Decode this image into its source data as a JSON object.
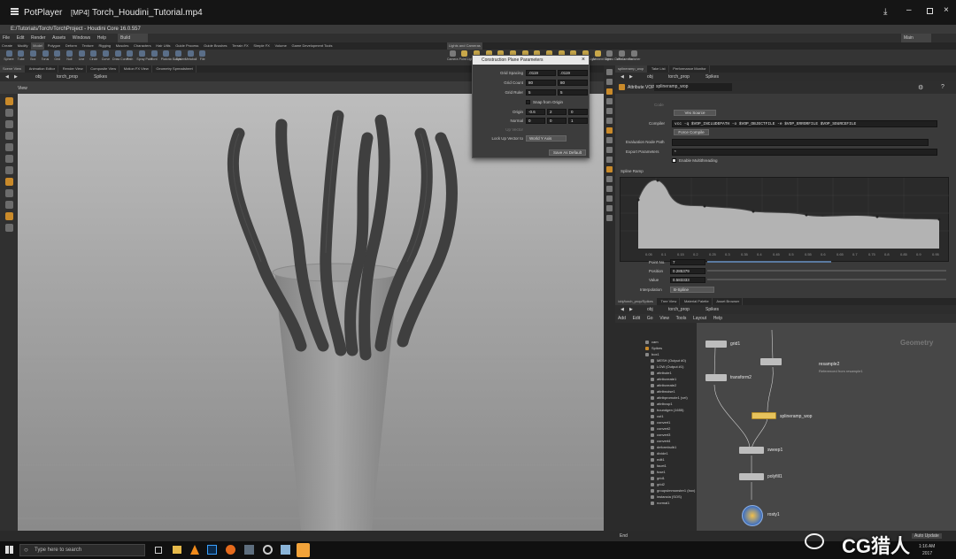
{
  "player": {
    "app_name": "PotPlayer",
    "format": "[MP4]",
    "file_name": "Torch_Houdini_Tutorial.mp4",
    "controls": [
      "download-icon",
      "minimize-icon",
      "restore-icon",
      "close-icon"
    ]
  },
  "houdini": {
    "title": "E:/Tutorials/Torch/TorchProject - Houdini Core 16.0.557",
    "desktop": "Build",
    "main_menu": "Main",
    "menu": [
      "File",
      "Edit",
      "Render",
      "Assets",
      "Windows",
      "Help"
    ],
    "shelf_tabs": [
      "Create",
      "Modify",
      "Model",
      "Polygon",
      "Deform",
      "Texture",
      "Rigging",
      "Muscles",
      "Characters",
      "Hair Utils",
      "Guide Process",
      "Guide Brushes",
      "Terrain FX",
      "Simple FX",
      "Volume",
      "Game Development Tools"
    ],
    "shelf_tools": [
      "Sphere",
      "Tube",
      "Box",
      "Torus",
      "Grid",
      "Null",
      "Line",
      "Circle",
      "Curve",
      "Draw Curve",
      "Path",
      "Spray Paint",
      "Font",
      "Platonic Solids",
      "L-System",
      "Metaball",
      "File"
    ],
    "right_shelf_tabs": [
      "Lights and Cameras"
    ],
    "right_shelf_tools": [
      "Camera",
      "Point Light",
      "Spot Light",
      "Area Light",
      "Geometry Light",
      "Volume Light",
      "Distant Light",
      "Environment Light",
      "Sky Light",
      "GI Light",
      "Caustic Light",
      "Portal Light",
      "Ambient Light",
      "Stereo Camera",
      "VR Camera",
      "Switcher"
    ],
    "pane_tabs": [
      "Scene View",
      "Animation Editor",
      "Render View",
      "Composite View",
      "Motion FX View",
      "Geometry Spreadsheet"
    ],
    "path": {
      "obj": "obj",
      "node": "torch_prop",
      "child": "Spikes"
    },
    "view_label": "View"
  },
  "dialog": {
    "title": "Construction Plane Parameters",
    "rows": [
      {
        "label": "Grid Spacing",
        "v1": ".0119",
        "v2": ".0119"
      },
      {
        "label": "Grid Count",
        "v1": "80",
        "v2": "80"
      },
      {
        "label": "Grid Ruler",
        "v1": "5",
        "v2": "5"
      }
    ],
    "snap_label": "Snap from Origin",
    "origin": {
      "label": "Origin",
      "v": [
        "-0.6",
        "2",
        "0"
      ]
    },
    "normal": {
      "label": "Normal",
      "v": [
        "0",
        "0",
        "1"
      ]
    },
    "up_vector_label": "Up Vector",
    "lock_label": "Lock Up Vector to",
    "lock_value": "World Y Axis",
    "save_label": "Save As Default"
  },
  "params": {
    "tabs": [
      "splineramp_wop",
      "Take List",
      "Performance Monitor"
    ],
    "path": {
      "obj": "obj",
      "node": "torch_prop",
      "child": "Spikes"
    },
    "node_type": "Attribute VOP",
    "node_name": "splineramp_wop",
    "code_label": "Code",
    "code_btn": "Vex Source",
    "compiler_label": "Compiler",
    "compiler_value": "vcc -q $VOP_INCLUDEPATH -o $VOP_OBJECTFILE -e $VOP_ERRORFILE $VOP_SOURCEFILE",
    "force_compile": "Force Compile",
    "eval_label": "Evaluation Node Path",
    "export_label": "Export Parameters",
    "export_value": "*",
    "multithread_label": "Enable Multithreading",
    "ramp_label": "Spline Ramp",
    "ramp_ticks": [
      "0.05",
      "0.1",
      "0.15",
      "0.2",
      "0.25",
      "0.3",
      "0.35",
      "0.4",
      "0.45",
      "0.5",
      "0.55",
      "0.6",
      "0.65",
      "0.7",
      "0.75",
      "0.8",
      "0.85",
      "0.9",
      "0.95"
    ],
    "point_no_label": "Point No.",
    "point_no": "7",
    "position_label": "Position",
    "position": "0.285379",
    "value_label": "Value",
    "value": "0.583333",
    "interp_label": "Interpolation",
    "interp": "B-Spline"
  },
  "network": {
    "tabs": [
      "/obj/torch_prop/Spikes",
      "Tree View",
      "Material Palette",
      "Asset Browser"
    ],
    "path": {
      "obj": "obj",
      "node": "torch_prop",
      "child": "Spikes"
    },
    "menu": [
      "Add",
      "Edit",
      "Go",
      "View",
      "Tools",
      "Layout",
      "Help"
    ],
    "context": "Geometry",
    "tree": [
      "cam",
      "Spikes",
      "box1",
      "MESH (Output #0)",
      "LOW (Output #1)",
      "attribute1",
      "attribcreate1",
      "attribcreate2",
      "attribnoise1",
      "attribpromote1 (vel)",
      "attribvop1",
      "boundgen (1655)",
      "cut1",
      "convert1",
      "convert2",
      "convert3",
      "convert4",
      "deformbulb1",
      "divide1",
      "edit1",
      "facet1",
      "fuse1",
      "grid1",
      "grid2",
      "groupsimmonster1 (box)",
      "instancia (SOS)",
      "normal1"
    ],
    "nodes": [
      {
        "label": "grid1"
      },
      {
        "label": "transform2"
      },
      {
        "label": "resample2",
        "sub": "Referenced from resample1"
      },
      {
        "label": "splineramp_wop"
      },
      {
        "label": "sweep1"
      },
      {
        "label": "polyfill1"
      },
      {
        "label": "rosty1"
      }
    ]
  },
  "status": {
    "auto_update": "Auto Update",
    "end_label": "End"
  },
  "taskbar": {
    "search": "Type here to search",
    "time": "1:16 AM",
    "date": "2017"
  },
  "watermark": "CG猎人",
  "colors": {
    "accent": "#c98a2a",
    "node_selected": "#e7c35c",
    "viewport": "#a6a6a6"
  }
}
